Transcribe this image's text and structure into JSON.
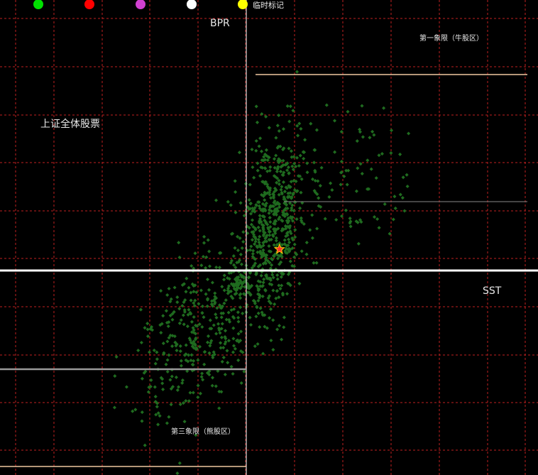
{
  "chart_data": {
    "type": "scatter",
    "title": "上证全体股票",
    "xlabel": "SST",
    "ylabel": "BPR",
    "quadrant_labels": {
      "q1": "第一象限（牛股区）",
      "q3": "第三象限（熊股区）"
    },
    "legend": {
      "placement": "top-left",
      "items": [
        {
          "color": "#00e000",
          "label": ""
        },
        {
          "color": "#ff0000",
          "label": ""
        },
        {
          "color": "#d040d0",
          "label": ""
        },
        {
          "color": "#ffffff",
          "label": ""
        },
        {
          "color": "#ffff00",
          "label": "临时标记"
        }
      ]
    },
    "grid": true,
    "colors": {
      "background": "#000000",
      "grid": "#c02020",
      "axis": "#ffffff",
      "points": "#1f6b1f",
      "ref_line": "#f0c8a0",
      "marker": "#ff3030"
    },
    "xlim": [
      -1,
      1
    ],
    "ylim": [
      -1,
      1
    ],
    "marker_point": {
      "x": 0.13,
      "y": 0.1
    },
    "seed": 20240517
  }
}
